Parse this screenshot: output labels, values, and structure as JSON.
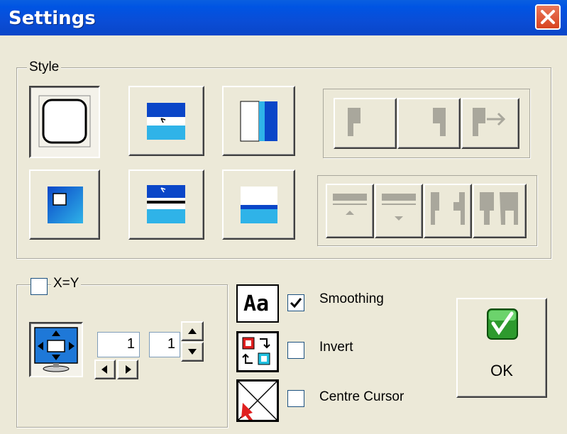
{
  "window": {
    "title": "Settings",
    "close_icon": "close-icon"
  },
  "style_group": {
    "legend": "Style"
  },
  "xy_group": {
    "legend": "X=Y",
    "x_value": "1",
    "y_value": "1"
  },
  "options": [
    {
      "label": "Smoothing",
      "checked": true,
      "icon": "font-aa-icon"
    },
    {
      "label": "Invert",
      "checked": false,
      "icon": "invert-colors-icon"
    },
    {
      "label": "Centre Cursor",
      "checked": false,
      "icon": "centre-cursor-icon"
    }
  ],
  "ok_button": {
    "label": "OK",
    "icon": "green-check-icon"
  },
  "font_icon_text": "Aa",
  "colors": {
    "titlebar": "#0054e3",
    "face": "#ece9d8",
    "close": "#d8431f",
    "accent_blue": "#0a46c8",
    "sky": "#2fb3e8",
    "ok_green": "#2e9a2e"
  }
}
